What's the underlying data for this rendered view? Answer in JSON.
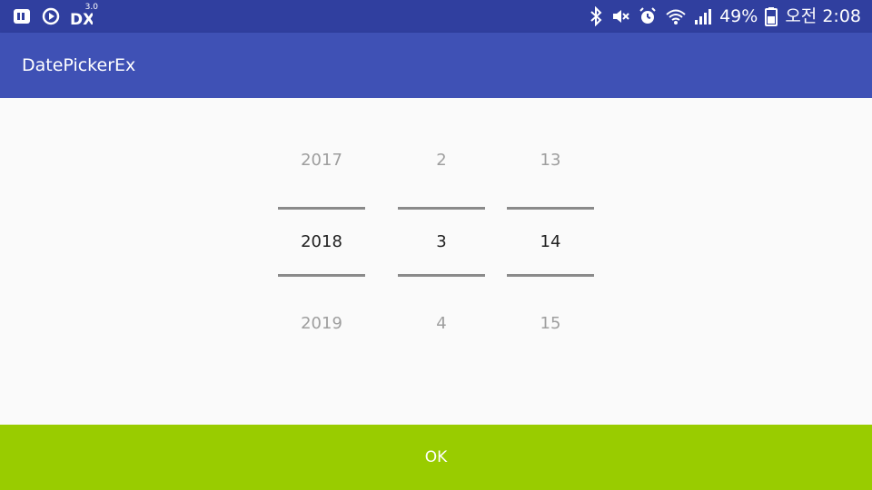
{
  "status_bar": {
    "icons_left": [
      "app-notification-icon",
      "play-icon",
      "dx-icon"
    ],
    "icons_right": [
      "bluetooth-icon",
      "mute-icon",
      "alarm-icon",
      "wifi-icon",
      "signal-icon",
      "battery-icon"
    ],
    "battery_percent": "49%",
    "time": "오전 2:08",
    "dx_badge": "3.0"
  },
  "app_bar": {
    "title": "DatePickerEx",
    "color": "#3f51b5"
  },
  "date_picker": {
    "year": {
      "prev": "2017",
      "selected": "2018",
      "next": "2019"
    },
    "month": {
      "prev": "2",
      "selected": "3",
      "next": "4"
    },
    "day": {
      "prev": "13",
      "selected": "14",
      "next": "15"
    }
  },
  "ok_button": {
    "label": "OK",
    "color": "#99cc00"
  }
}
